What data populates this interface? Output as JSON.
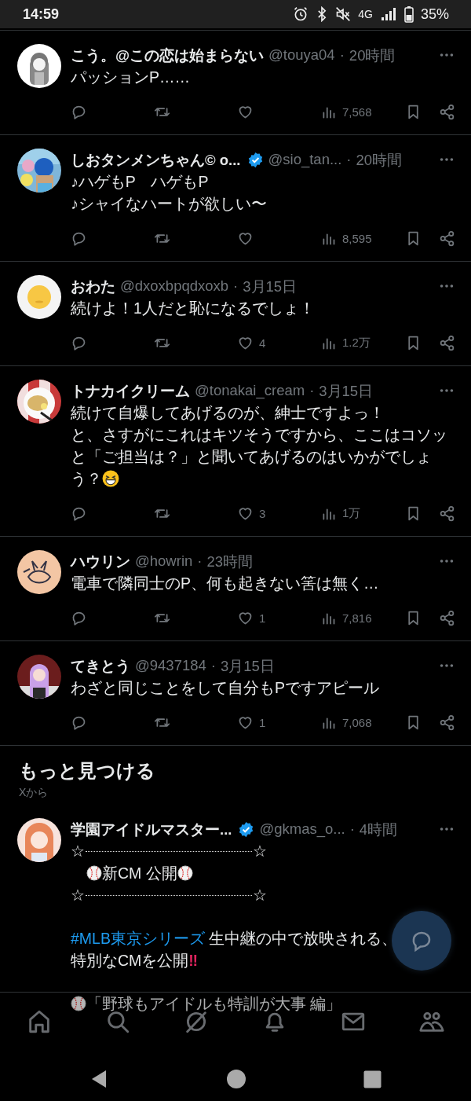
{
  "status_bar": {
    "time": "14:59",
    "network": "4G",
    "battery": "35%"
  },
  "tweets": [
    {
      "name": "こう。@この恋は始まらない",
      "verified": false,
      "handle": "@touya04",
      "separator": "·",
      "time": "20時間",
      "body": [
        [
          "パッションP……"
        ]
      ],
      "views": "7,568"
    },
    {
      "name": "しおタンメンちゃん© o...",
      "verified": true,
      "handle": "@sio_tan...",
      "separator": "·",
      "time": "20時間",
      "body": [
        [
          "♪ハゲもP　ハゲもP",
          "♪シャイなハートが欲しい〜"
        ]
      ],
      "views": "8,595"
    },
    {
      "name": "おわた",
      "verified": false,
      "handle": "@dxoxbpqdxoxb",
      "separator": "·",
      "time": "3月15日",
      "body": [
        [
          "続けよ！1人だと恥になるでしょ！"
        ]
      ],
      "likes": "4",
      "views": "1.2万"
    },
    {
      "name": "トナカイクリーム",
      "verified": false,
      "handle": "@tonakai_cream",
      "separator": "·",
      "time": "3月15日",
      "body": [
        [
          "続けて自爆してあげるのが、紳士ですよっ！",
          "と、さすがにこれはキツそうですから、ここはコソッ",
          "と「ご担当は？」と聞いてあげるのはいかがでしょ",
          [
            {
              "kind": "text",
              "text": "う？"
            },
            {
              "kind": "grin"
            }
          ]
        ]
      ],
      "likes": "3",
      "views": "1万"
    },
    {
      "name": "ハウリン",
      "verified": false,
      "handle": "@howrin",
      "separator": "·",
      "time": "23時間",
      "body": [
        [
          "電車で隣同士のP、何も起きない筈は無く…"
        ]
      ],
      "likes": "1",
      "views": "7,816"
    },
    {
      "name": "てきとう",
      "verified": false,
      "handle": "@9437184",
      "separator": "·",
      "time": "3月15日",
      "body": [
        [
          "わざと同じことをして自分もPですアピール"
        ]
      ],
      "likes": "1",
      "views": "7,068"
    }
  ],
  "discover": {
    "title": "もっと見つける",
    "subtitle": "Xから",
    "tweets": [
      {
        "name": "学園アイドルマスター...",
        "verified": true,
        "handle": "@gkmas_o...",
        "separator": "·",
        "time": "4時間",
        "body": [
          [
            [
              {
                "kind": "text",
                "text": "☆"
              },
              {
                "kind": "dots"
              },
              {
                "kind": "text",
                "text": "☆"
              }
            ],
            [
              {
                "kind": "indent"
              },
              {
                "kind": "baseball"
              },
              {
                "kind": "text",
                "text": "新CM 公開"
              },
              {
                "kind": "baseball"
              }
            ],
            [
              {
                "kind": "text",
                "text": "☆"
              },
              {
                "kind": "dots"
              },
              {
                "kind": "text",
                "text": "☆"
              }
            ]
          ],
          [
            [
              {
                "kind": "hashtag",
                "text": "#MLB東京シリーズ"
              },
              {
                "kind": "text",
                "text": " 生中継の中で放映される、"
              }
            ],
            [
              {
                "kind": "text",
                "text": "特別なCMを公開"
              },
              {
                "kind": "alert",
                "text": "‼"
              }
            ]
          ],
          [
            [
              {
                "kind": "baseball"
              },
              {
                "kind": "text",
                "text": "「野球もアイドルも特訓が大事 編」"
              }
            ]
          ]
        ]
      }
    ]
  }
}
